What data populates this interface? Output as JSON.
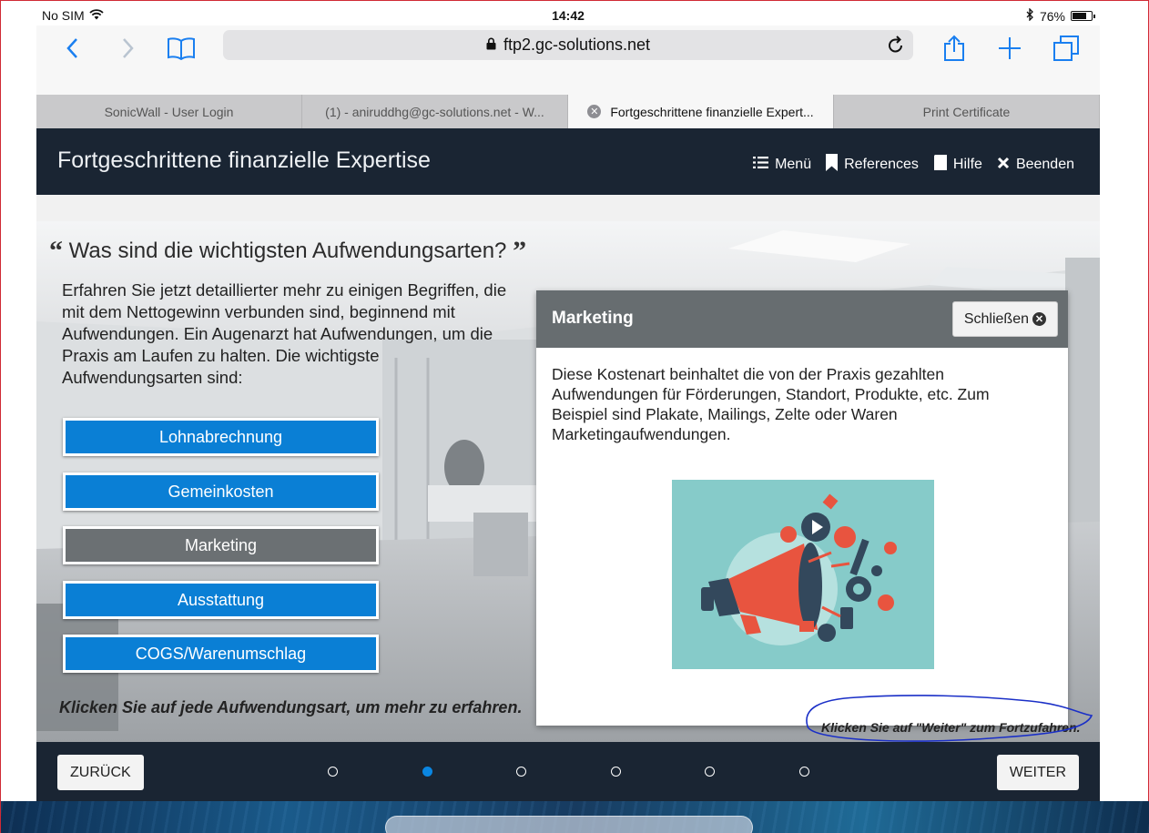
{
  "status_bar": {
    "carrier": "No SIM",
    "time": "14:42",
    "battery": "76%",
    "battery_level": 0.76
  },
  "browser": {
    "url": "ftp2.gc-solutions.net"
  },
  "tabs": [
    {
      "label": "SonicWall - User Login",
      "active": false
    },
    {
      "label": "(1) - aniruddhg@gc-solutions.net - W...",
      "active": false
    },
    {
      "label": "Fortgeschrittene finanzielle Expert...",
      "active": true
    },
    {
      "label": "Print Certificate",
      "active": false
    }
  ],
  "course": {
    "title": "Fortgeschrittene finanzielle Expertise",
    "nav": {
      "menu": "Menü",
      "references": "References",
      "help": "Hilfe",
      "exit": "Beenden"
    }
  },
  "slide": {
    "question": "Was sind die wichtigsten Aufwendungsarten?",
    "intro": "Erfahren Sie jetzt detaillierter mehr zu einigen Begriffen, die mit dem Nettogewinn verbunden sind, beginnend mit Aufwendungen. Ein Augenarzt hat Aufwendungen, um die Praxis am Laufen zu halten. Die wichtigste Aufwendungsarten sind:",
    "buttons": [
      {
        "label": "Lohnabrechnung",
        "selected": false
      },
      {
        "label": "Gemeinkosten",
        "selected": false
      },
      {
        "label": "Marketing",
        "selected": true
      },
      {
        "label": "Ausstattung",
        "selected": false
      },
      {
        "label": "COGS/Warenumschlag",
        "selected": false
      }
    ],
    "instruction_left": "Klicken Sie auf jede Aufwendungsart, um mehr zu erfahren.",
    "instruction_right": "Klicken Sie auf \"Weiter\" zum Fortzufahren."
  },
  "popup": {
    "title": "Marketing",
    "close_label": "Schließen",
    "body": "Diese Kostenart beinhaltet die von der Praxis gezahlten Aufwendungen für Förderungen, Standort, Produkte, etc. Zum Beispiel sind Plakate, Mailings, Zelte oder Waren Marketingaufwendungen."
  },
  "footer": {
    "back_label": "ZURÜCK",
    "next_label": "WEITER",
    "page_count": 6,
    "current_page": 2
  },
  "colors": {
    "header_bg": "#1a2533",
    "accent_blue": "#0a7fd5",
    "selected_gray": "#6b7073",
    "popup_header": "#676d70",
    "ios_blue": "#1a7ff0"
  }
}
